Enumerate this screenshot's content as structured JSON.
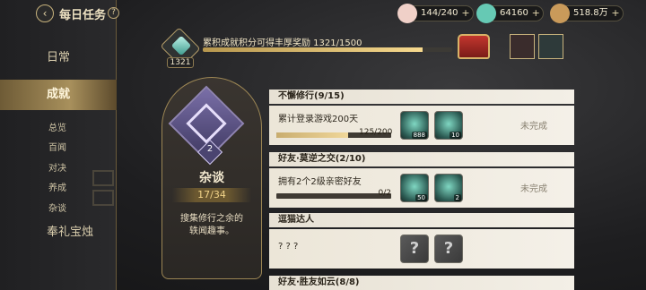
{
  "header": {
    "back_icon": "back-arrow-icon",
    "title": "每日任务",
    "help_label": "?"
  },
  "resources": [
    {
      "icon": "peach-stamina-icon",
      "value": "144/240",
      "color": "#f0d0c8"
    },
    {
      "icon": "jade-gem-icon",
      "value": "64160",
      "color": "#66c9b4"
    },
    {
      "icon": "coin-pouch-icon",
      "value": "518.8万",
      "color": "#c99a5a"
    }
  ],
  "sidebar": {
    "items": [
      {
        "label": "日常",
        "active": false
      },
      {
        "label": "成就",
        "active": true
      },
      {
        "label": "总览"
      },
      {
        "label": "百闻"
      },
      {
        "label": "对决"
      },
      {
        "label": "养成"
      },
      {
        "label": "杂谈"
      },
      {
        "label": "奉礼宝烛",
        "active": false
      }
    ]
  },
  "accumulate": {
    "points": "1321",
    "label": "累积成就积分可得丰厚奖励 1321/1500",
    "progress": 0.8807
  },
  "category": {
    "level": "2",
    "name": "杂谈",
    "count": "17/34",
    "desc_line1": "搜集修行之余的",
    "desc_line2": "轶闻趣事。"
  },
  "groups": [
    {
      "title": "不懈修行(9/15)",
      "task": {
        "desc": "累计登录游戏200天",
        "progress_text": "125/200",
        "progress": 0.625,
        "rewards": [
          {
            "icon": "jade-gem-icon",
            "qty": "888"
          },
          {
            "icon": "reward-chest-icon",
            "qty": "10"
          }
        ],
        "status": "未完成"
      }
    },
    {
      "title": "好友·莫逆之交(2/10)",
      "task": {
        "desc": "拥有2个2级亲密好友",
        "progress_text": "0/2",
        "progress": 0.0,
        "rewards": [
          {
            "icon": "jade-gem-icon",
            "qty": "50"
          },
          {
            "icon": "reward-chest-icon",
            "qty": "2"
          }
        ],
        "status": "未完成"
      }
    },
    {
      "title": "逗猫达人",
      "task": {
        "desc": "? ? ?",
        "rewards": [
          {
            "icon": "unknown-reward-icon",
            "qty": "?"
          },
          {
            "icon": "unknown-reward-icon",
            "qty": "?"
          }
        ],
        "status": ""
      }
    },
    {
      "title": "好友·胜友如云(8/8)"
    }
  ]
}
